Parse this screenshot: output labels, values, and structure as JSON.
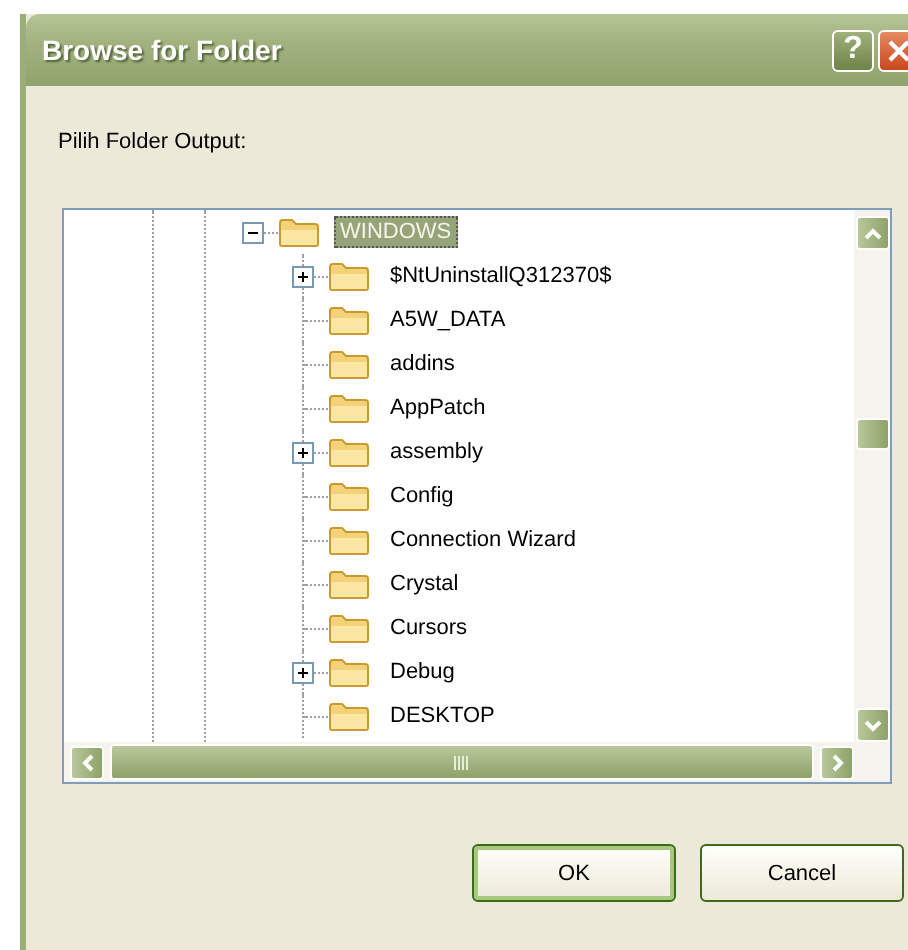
{
  "window": {
    "title": "Browse for Folder"
  },
  "title_buttons": [
    {
      "kind": "help",
      "label": "?"
    },
    {
      "kind": "close"
    }
  ],
  "prompt": "Pilih Folder Output:",
  "tree": {
    "items": [
      {
        "label": "WINDOWS",
        "expandable": true,
        "expanded": true,
        "selected": true,
        "children": [
          {
            "label": "$NtUninstallQ312370$",
            "expandable": true,
            "selected": false
          },
          {
            "label": "A5W_DATA",
            "expandable": false,
            "selected": false
          },
          {
            "label": "addins",
            "expandable": false,
            "selected": false
          },
          {
            "label": "AppPatch",
            "expandable": false,
            "selected": false
          },
          {
            "label": "assembly",
            "expandable": true,
            "selected": false
          },
          {
            "label": "Config",
            "expandable": false,
            "selected": false
          },
          {
            "label": "Connection Wizard",
            "expandable": false,
            "selected": false
          },
          {
            "label": "Crystal",
            "expandable": false,
            "selected": false
          },
          {
            "label": "Cursors",
            "expandable": false,
            "selected": false
          },
          {
            "label": "Debug",
            "expandable": true,
            "selected": false
          },
          {
            "label": "DESKTOP",
            "expandable": false,
            "selected": false
          }
        ]
      }
    ]
  },
  "buttons": [
    {
      "label": "OK",
      "default": true
    },
    {
      "label": "Cancel",
      "default": false
    }
  ]
}
